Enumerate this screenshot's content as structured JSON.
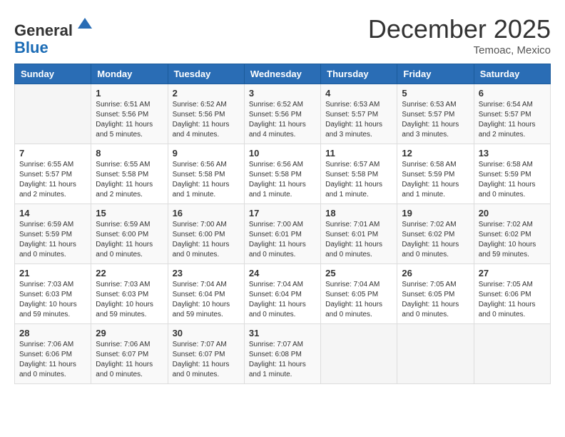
{
  "logo": {
    "general": "General",
    "blue": "Blue"
  },
  "title": "December 2025",
  "location": "Temoac, Mexico",
  "days_of_week": [
    "Sunday",
    "Monday",
    "Tuesday",
    "Wednesday",
    "Thursday",
    "Friday",
    "Saturday"
  ],
  "weeks": [
    [
      {
        "day": "",
        "info": ""
      },
      {
        "day": "1",
        "info": "Sunrise: 6:51 AM\nSunset: 5:56 PM\nDaylight: 11 hours\nand 5 minutes."
      },
      {
        "day": "2",
        "info": "Sunrise: 6:52 AM\nSunset: 5:56 PM\nDaylight: 11 hours\nand 4 minutes."
      },
      {
        "day": "3",
        "info": "Sunrise: 6:52 AM\nSunset: 5:56 PM\nDaylight: 11 hours\nand 4 minutes."
      },
      {
        "day": "4",
        "info": "Sunrise: 6:53 AM\nSunset: 5:57 PM\nDaylight: 11 hours\nand 3 minutes."
      },
      {
        "day": "5",
        "info": "Sunrise: 6:53 AM\nSunset: 5:57 PM\nDaylight: 11 hours\nand 3 minutes."
      },
      {
        "day": "6",
        "info": "Sunrise: 6:54 AM\nSunset: 5:57 PM\nDaylight: 11 hours\nand 2 minutes."
      }
    ],
    [
      {
        "day": "7",
        "info": "Sunrise: 6:55 AM\nSunset: 5:57 PM\nDaylight: 11 hours\nand 2 minutes."
      },
      {
        "day": "8",
        "info": "Sunrise: 6:55 AM\nSunset: 5:58 PM\nDaylight: 11 hours\nand 2 minutes."
      },
      {
        "day": "9",
        "info": "Sunrise: 6:56 AM\nSunset: 5:58 PM\nDaylight: 11 hours\nand 1 minute."
      },
      {
        "day": "10",
        "info": "Sunrise: 6:56 AM\nSunset: 5:58 PM\nDaylight: 11 hours\nand 1 minute."
      },
      {
        "day": "11",
        "info": "Sunrise: 6:57 AM\nSunset: 5:58 PM\nDaylight: 11 hours\nand 1 minute."
      },
      {
        "day": "12",
        "info": "Sunrise: 6:58 AM\nSunset: 5:59 PM\nDaylight: 11 hours\nand 1 minute."
      },
      {
        "day": "13",
        "info": "Sunrise: 6:58 AM\nSunset: 5:59 PM\nDaylight: 11 hours\nand 0 minutes."
      }
    ],
    [
      {
        "day": "14",
        "info": "Sunrise: 6:59 AM\nSunset: 5:59 PM\nDaylight: 11 hours\nand 0 minutes."
      },
      {
        "day": "15",
        "info": "Sunrise: 6:59 AM\nSunset: 6:00 PM\nDaylight: 11 hours\nand 0 minutes."
      },
      {
        "day": "16",
        "info": "Sunrise: 7:00 AM\nSunset: 6:00 PM\nDaylight: 11 hours\nand 0 minutes."
      },
      {
        "day": "17",
        "info": "Sunrise: 7:00 AM\nSunset: 6:01 PM\nDaylight: 11 hours\nand 0 minutes."
      },
      {
        "day": "18",
        "info": "Sunrise: 7:01 AM\nSunset: 6:01 PM\nDaylight: 11 hours\nand 0 minutes."
      },
      {
        "day": "19",
        "info": "Sunrise: 7:02 AM\nSunset: 6:02 PM\nDaylight: 11 hours\nand 0 minutes."
      },
      {
        "day": "20",
        "info": "Sunrise: 7:02 AM\nSunset: 6:02 PM\nDaylight: 10 hours\nand 59 minutes."
      }
    ],
    [
      {
        "day": "21",
        "info": "Sunrise: 7:03 AM\nSunset: 6:03 PM\nDaylight: 10 hours\nand 59 minutes."
      },
      {
        "day": "22",
        "info": "Sunrise: 7:03 AM\nSunset: 6:03 PM\nDaylight: 10 hours\nand 59 minutes."
      },
      {
        "day": "23",
        "info": "Sunrise: 7:04 AM\nSunset: 6:04 PM\nDaylight: 10 hours\nand 59 minutes."
      },
      {
        "day": "24",
        "info": "Sunrise: 7:04 AM\nSunset: 6:04 PM\nDaylight: 11 hours\nand 0 minutes."
      },
      {
        "day": "25",
        "info": "Sunrise: 7:04 AM\nSunset: 6:05 PM\nDaylight: 11 hours\nand 0 minutes."
      },
      {
        "day": "26",
        "info": "Sunrise: 7:05 AM\nSunset: 6:05 PM\nDaylight: 11 hours\nand 0 minutes."
      },
      {
        "day": "27",
        "info": "Sunrise: 7:05 AM\nSunset: 6:06 PM\nDaylight: 11 hours\nand 0 minutes."
      }
    ],
    [
      {
        "day": "28",
        "info": "Sunrise: 7:06 AM\nSunset: 6:06 PM\nDaylight: 11 hours\nand 0 minutes."
      },
      {
        "day": "29",
        "info": "Sunrise: 7:06 AM\nSunset: 6:07 PM\nDaylight: 11 hours\nand 0 minutes."
      },
      {
        "day": "30",
        "info": "Sunrise: 7:07 AM\nSunset: 6:07 PM\nDaylight: 11 hours\nand 0 minutes."
      },
      {
        "day": "31",
        "info": "Sunrise: 7:07 AM\nSunset: 6:08 PM\nDaylight: 11 hours\nand 1 minute."
      },
      {
        "day": "",
        "info": ""
      },
      {
        "day": "",
        "info": ""
      },
      {
        "day": "",
        "info": ""
      }
    ]
  ]
}
